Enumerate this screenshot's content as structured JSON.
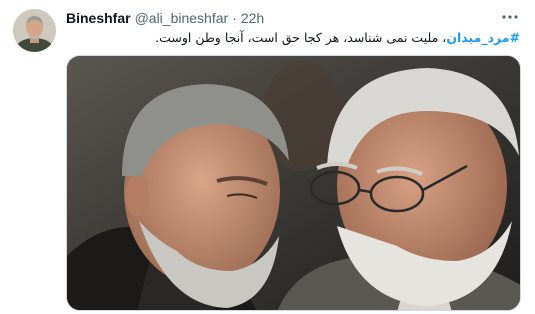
{
  "author": {
    "display_name": "Bineshfar",
    "handle": "@ali_bineshfar",
    "separator": "·",
    "time": "22h"
  },
  "tweet": {
    "hashtag": "#مرد_میدان",
    "text": "، ملیت نمی شناسد، هر کجا حق است، آنجا وطن اوست."
  },
  "icons": {
    "more": "more-dots-icon",
    "avatar": "avatar-image"
  },
  "colors": {
    "hashtag": "#1d9bf0",
    "name": "#0f1419",
    "secondary": "#536471"
  }
}
